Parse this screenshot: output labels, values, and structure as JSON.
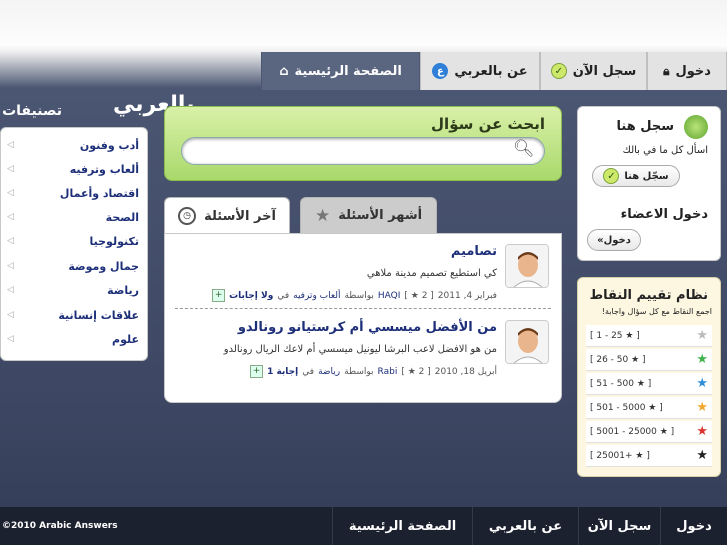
{
  "nav": {
    "tabs": [
      {
        "label": "الصفحة الرئيسية",
        "icon": "home-icon",
        "active": true
      },
      {
        "label": "عن بالعربي",
        "icon": "info-icon"
      },
      {
        "label": "سجل الآن",
        "icon": "check-icon"
      },
      {
        "label": "دخول",
        "icon": "lock-icon"
      }
    ]
  },
  "logo": {
    "text": "بالعربي"
  },
  "categories": {
    "title": "تصنيفات",
    "items": [
      "أدب وفنون",
      "ألعاب وترفيه",
      "اقتصاد وأعمال",
      "الصحة",
      "تكنولوجيا",
      "جمال وموضة",
      "رياضة",
      "علاقات إنسانية",
      "علوم"
    ]
  },
  "search": {
    "title": "ابحث عن سؤال",
    "placeholder": ""
  },
  "question_tabs": {
    "latest": "آخر الأسئلة",
    "popular": "أشهر الأسئلة"
  },
  "questions": [
    {
      "title": "تصاميم",
      "desc": "كي استطيع تصميم مدينة ملاهي",
      "date": "فبراير 4, 2011",
      "rank": "2",
      "user": "HAQI",
      "by": "بواسطة",
      "in": "في",
      "category": "ألعاب وترفيه",
      "answers": "ولا إجابات"
    },
    {
      "title": "من الأفضل ميسسي أم كرستيانو رونالدو",
      "desc": "من هو الافضل لاعب البرشا ليونيل ميسسي أم لاعك الريال رونالدو",
      "date": "أبريل 18, 2010",
      "rank": "2",
      "user": "Rabi",
      "by": "بواسطة",
      "in": "في",
      "category": "رياضة",
      "answers": "إجابة 1"
    }
  ],
  "register": {
    "title": "سجل هنا",
    "text": "اسأل كل ما في بالك",
    "button": "سجّل هنا"
  },
  "login": {
    "title": "دخول الاعضاء",
    "button": "دخول»"
  },
  "points": {
    "title": "نظام تقييم النقاط",
    "subtitle": "اجمع النقاط مع كل سؤال واجابة!",
    "levels": [
      {
        "range": "[ 1 - 25 ★ ]",
        "color": "#bbbbbb"
      },
      {
        "range": "[ 26 - 50 ★ ]",
        "color": "#3fb24b"
      },
      {
        "range": "[ 51 - 500 ★ ]",
        "color": "#2f8fd8"
      },
      {
        "range": "[ 501 - 5000 ★ ]",
        "color": "#f2a72e"
      },
      {
        "range": "[ 5001 - 25000 ★ ]",
        "color": "#d9352e"
      },
      {
        "range": "[ 25001+ ★ ]",
        "color": "#222222"
      }
    ]
  },
  "footer": {
    "copyright": "©2010 Arabic Answers",
    "links": [
      "دخول",
      "سجل الآن",
      "عن بالعربي",
      "الصفحة الرئيسية"
    ]
  }
}
